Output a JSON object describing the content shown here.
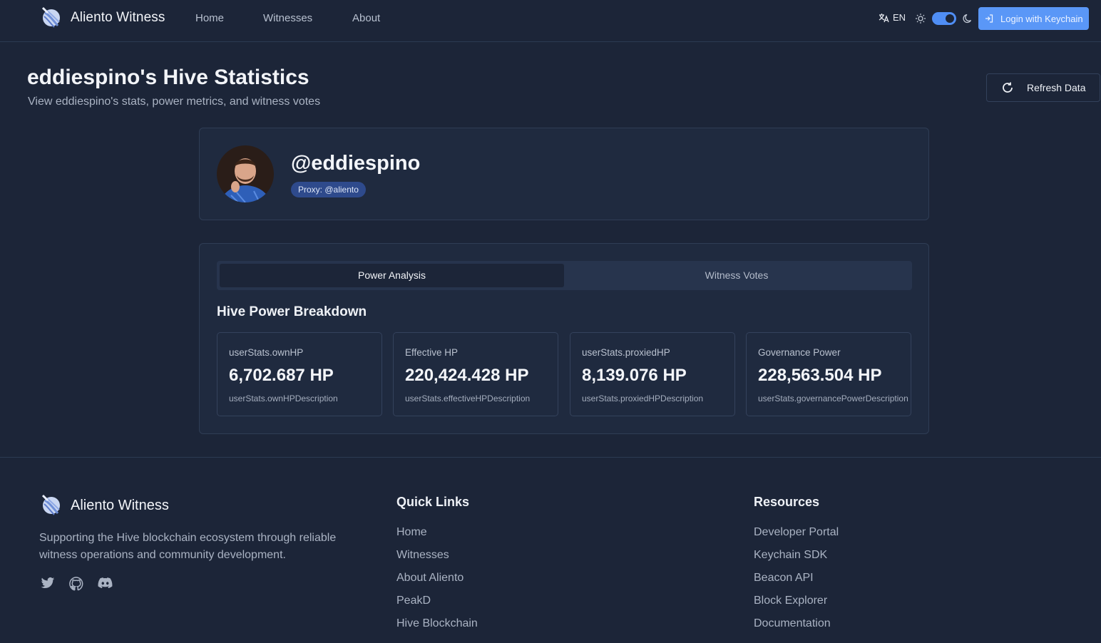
{
  "header": {
    "brand": "Aliento Witness",
    "nav": [
      "Home",
      "Witnesses",
      "About"
    ],
    "language": "EN",
    "login_label": "Login with Keychain",
    "accent_color": "#5a97f7"
  },
  "page": {
    "title": "eddiespino's Hive Statistics",
    "subtitle": "View eddiespino's stats, power metrics, and witness votes",
    "refresh_label": "Refresh Data"
  },
  "profile": {
    "username": "@eddiespino",
    "proxy": "Proxy: @aliento"
  },
  "tabs": {
    "items": [
      "Power Analysis",
      "Witness Votes"
    ],
    "active": "Power Analysis"
  },
  "breakdown": {
    "title": "Hive Power Breakdown",
    "stats": [
      {
        "label": "userStats.ownHP",
        "value": "6,702.687 HP",
        "description": "userStats.ownHPDescription"
      },
      {
        "label": "Effective HP",
        "value": "220,424.428 HP",
        "description": "userStats.effectiveHPDescription"
      },
      {
        "label": "userStats.proxiedHP",
        "value": "8,139.076 HP",
        "description": "userStats.proxiedHPDescription"
      },
      {
        "label": "Governance Power",
        "value": "228,563.504 HP",
        "description": "userStats.governancePowerDescription"
      }
    ]
  },
  "footer": {
    "brand": "Aliento Witness",
    "description": "Supporting the Hive blockchain ecosystem through reliable witness operations and community development.",
    "social_icons": [
      "twitter-icon",
      "github-icon",
      "discord-icon"
    ],
    "quick_links": {
      "title": "Quick Links",
      "items": [
        "Home",
        "Witnesses",
        "About Aliento",
        "PeakD",
        "Hive Blockchain"
      ]
    },
    "resources": {
      "title": "Resources",
      "items": [
        "Developer Portal",
        "Keychain SDK",
        "Beacon API",
        "Block Explorer",
        "Documentation"
      ]
    }
  }
}
